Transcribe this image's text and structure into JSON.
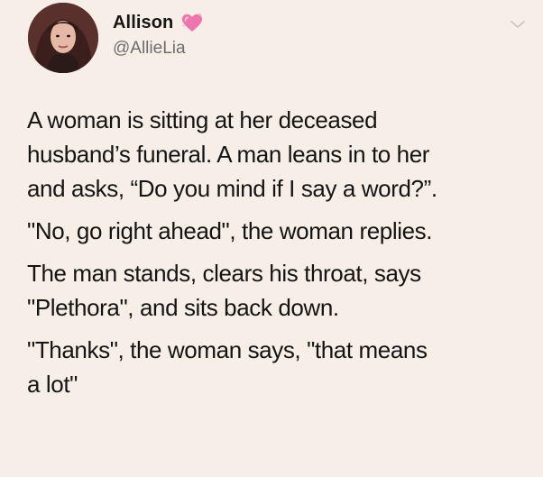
{
  "user": {
    "display_name": "Allison",
    "handle": "@AllieLia"
  },
  "icons": {
    "badge": "sparkling-heart-icon",
    "menu": "chevron-down-icon",
    "badge_color": "#e86aa8",
    "menu_color": "#c8c3c0"
  },
  "tweet": {
    "paragraphs": [
      {
        "lines": [
          "A woman is sitting at her deceased",
          "husband’s funeral. A man leans in to her",
          "and asks, “Do you mind if I say a word?”."
        ]
      },
      {
        "lines": [
          "\"No, go right ahead\", the woman replies."
        ]
      },
      {
        "lines": [
          "The man stands, clears his throat, says",
          "\"Plethora\", and sits back down."
        ]
      },
      {
        "lines": [
          "\"Thanks\", the woman says, \"that means",
          "a lot\""
        ]
      }
    ]
  }
}
